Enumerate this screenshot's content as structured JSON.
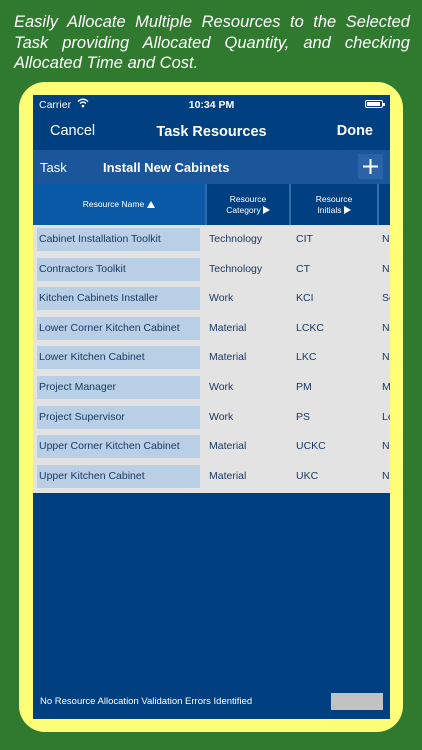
{
  "promo": {
    "text": "Easily Allocate Multiple Resources to the Selected Task providing Allocated Quantity, and checking Allocated Time and Cost."
  },
  "status_bar": {
    "carrier": "Carrier",
    "time": "10:34 PM"
  },
  "nav": {
    "cancel": "Cancel",
    "title": "Task Resources",
    "done": "Done"
  },
  "task": {
    "label": "Task",
    "name": "Install New Cabinets",
    "add_icon": "plus-icon"
  },
  "columns": {
    "name": "Resource Name",
    "category_line1": "Resource",
    "category_line2": "Category",
    "initials_line1": "Resource",
    "initials_line2": "Initials"
  },
  "rows": [
    {
      "name": "Cabinet Installation Toolkit",
      "category": "Technology",
      "initials": "CIT",
      "next": "N"
    },
    {
      "name": "Contractors Toolkit",
      "category": "Technology",
      "initials": "CT",
      "next": "N"
    },
    {
      "name": "Kitchen Cabinets Installer",
      "category": "Work",
      "initials": "KCI",
      "next": "Se"
    },
    {
      "name": "Lower Corner Kitchen Cabinet",
      "category": "Material",
      "initials": "LCKC",
      "next": "N"
    },
    {
      "name": "Lower Kitchen Cabinet",
      "category": "Material",
      "initials": "LKC",
      "next": "N"
    },
    {
      "name": "Project Manager",
      "category": "Work",
      "initials": "PM",
      "next": "M"
    },
    {
      "name": "Project Supervisor",
      "category": "Work",
      "initials": "PS",
      "next": "Le"
    },
    {
      "name": "Upper Corner Kitchen Cabinet",
      "category": "Material",
      "initials": "UCKC",
      "next": "N"
    },
    {
      "name": "Upper Kitchen Cabinet",
      "category": "Material",
      "initials": "UKC",
      "next": "N"
    }
  ],
  "footer": {
    "validation_text": "No Resource Allocation Validation Errors Identified"
  },
  "colors": {
    "background_green": "#2f7a2e",
    "frame_yellow": "#ffff77",
    "screen_blue": "#003f80",
    "task_bar_blue": "#1b559a",
    "name_cell": "#b8cfe6"
  }
}
